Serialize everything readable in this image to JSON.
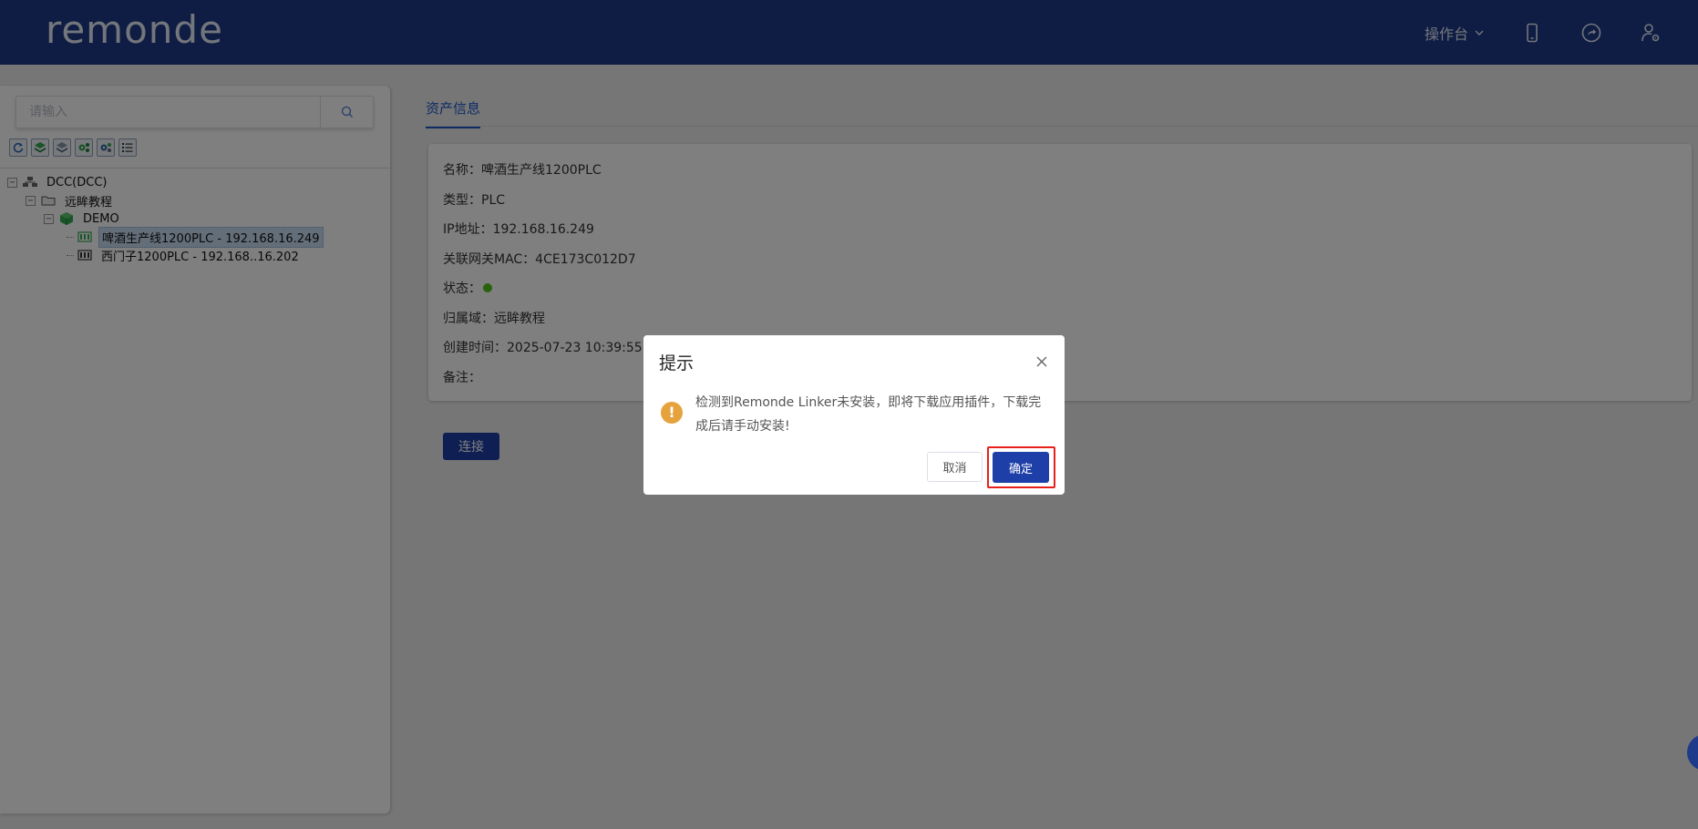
{
  "header": {
    "logo": "remonde",
    "console_label": "操作台",
    "icons": [
      "mobile-icon",
      "share-icon",
      "user-settings-icon"
    ]
  },
  "sidebar": {
    "search_placeholder": "请输入",
    "toolbar": [
      "refresh-icon",
      "layer-green-icon",
      "layer-gray-icon",
      "settings-green-icon",
      "settings-multi-icon",
      "list-icon"
    ],
    "tree": {
      "root": "DCC(DCC)",
      "folder": "远眸教程",
      "group": "DEMO",
      "device1": "啤酒生产线1200PLC - 192.168.16.249",
      "device2": "西门子1200PLC - 192.168..16.202"
    }
  },
  "main": {
    "tab_label": "资产信息",
    "info": {
      "name": "名称：啤酒生产线1200PLC",
      "type": "类型：PLC",
      "ip": "IP地址：192.168.16.249",
      "mac": "关联网关MAC：4CE173C012D7",
      "status_label": "状态：",
      "domain": "归属域：远眸教程",
      "created": "创建时间：2025-07-23 10:39:55",
      "remark": "备注："
    },
    "status_color": "#52c41a",
    "connect_label": "连接"
  },
  "dialog": {
    "title": "提示",
    "message": "检测到Remonde Linker未安装，即将下载应用插件，下载完成后请手动安装!",
    "cancel_label": "取消",
    "ok_label": "确定",
    "warn_color": "#e6a23c",
    "highlight_color": "#e8201c"
  },
  "colors": {
    "header_bg": "#1e3a8a",
    "accent": "#1c58c8",
    "primary_btn": "#1e3fa8"
  }
}
